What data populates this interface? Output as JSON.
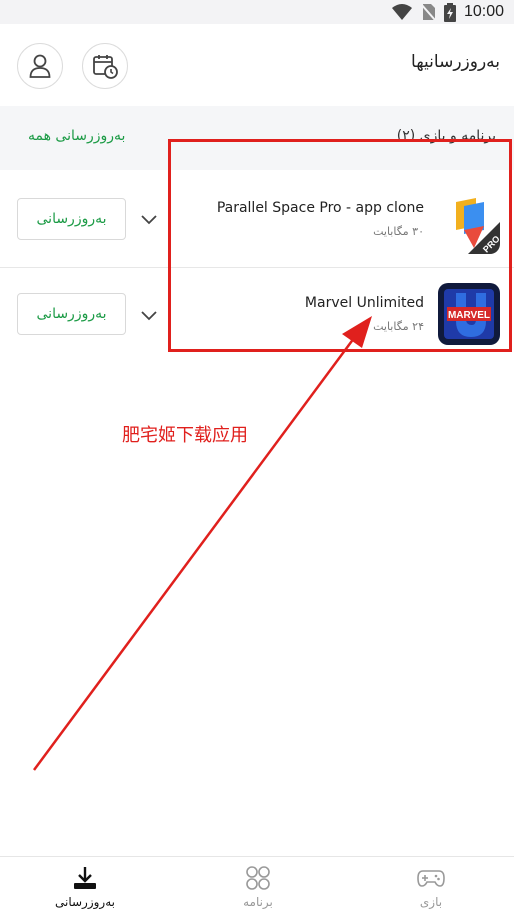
{
  "status_bar": {
    "time": "10:00"
  },
  "header": {
    "title": "بەروزرسانیها"
  },
  "section": {
    "count_label": "برنامه و بازی (۲)",
    "update_all_label": "بەروزرسانی همه"
  },
  "apps": [
    {
      "name": "Parallel Space Pro - app clone",
      "size": "۳۰ مگابایت",
      "button_label": "بەروزرسانی"
    },
    {
      "name": "Marvel Unlimited",
      "size": "۲۴ مگابایت",
      "button_label": "بەروزرسانی"
    }
  ],
  "annotation": {
    "text": "肥宅姬下载应用",
    "color": "#e0201d"
  },
  "bottom_nav": {
    "items": [
      {
        "label": "بەروزرسانی",
        "active": true
      },
      {
        "label": "برنامه",
        "active": false
      },
      {
        "label": "بازی",
        "active": false
      }
    ]
  },
  "colors": {
    "accent": "#1c9b46",
    "annotation": "#e0201d"
  }
}
